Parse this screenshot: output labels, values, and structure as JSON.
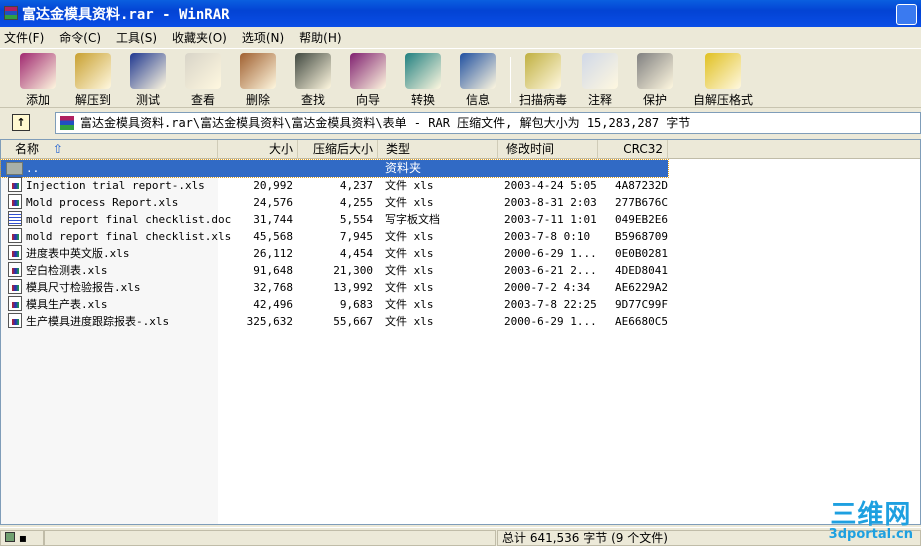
{
  "window": {
    "title": "富达金模具资料.rar - WinRAR"
  },
  "menu": [
    "文件(F)",
    "命令(C)",
    "工具(S)",
    "收藏夹(O)",
    "选项(N)",
    "帮助(H)"
  ],
  "toolbar": [
    {
      "label": "添加",
      "icon": "add-archive-icon",
      "color": "#a02870"
    },
    {
      "label": "解压到",
      "icon": "extract-icon",
      "color": "#c8a030"
    },
    {
      "label": "测试",
      "icon": "test-icon",
      "color": "#203890"
    },
    {
      "label": "查看",
      "icon": "view-icon",
      "color": "#d8d4c8"
    },
    {
      "label": "删除",
      "icon": "delete-icon",
      "color": "#a06030"
    },
    {
      "label": "查找",
      "icon": "find-icon",
      "color": "#404840"
    },
    {
      "label": "向导",
      "icon": "wizard-icon",
      "color": "#802070"
    },
    {
      "label": "转换",
      "icon": "convert-icon",
      "color": "#208080"
    },
    {
      "label": "信息",
      "icon": "info-icon",
      "color": "#2050a0"
    },
    {
      "label": "扫描病毒",
      "icon": "virus-scan-icon",
      "color": "#c0b040"
    },
    {
      "label": "注释",
      "icon": "comment-icon",
      "color": "#d0d8e8"
    },
    {
      "label": "保护",
      "icon": "protect-icon",
      "color": "#808080"
    },
    {
      "label": "自解压格式",
      "icon": "sfx-icon",
      "color": "#e0c020"
    }
  ],
  "address": {
    "path": "富达金模具资料.rar\\富达金模具资料\\富达金模具资料\\表单 - RAR 压缩文件, 解包大小为 15,283,287 字节"
  },
  "columns": {
    "name": "名称",
    "size": "大小",
    "packed": "压缩后大小",
    "type": "类型",
    "modified": "修改时间",
    "crc": "CRC32"
  },
  "parent_row": {
    "name": "..",
    "type": "资料夹"
  },
  "files": [
    {
      "name": "Injection trial report-.xls",
      "size": "20,992",
      "packed": "4,237",
      "type": "文件 xls",
      "modified": "2003-4-24 5:05",
      "crc": "4A87232D",
      "kind": "xls"
    },
    {
      "name": "Mold process Report.xls",
      "size": "24,576",
      "packed": "4,255",
      "type": "文件 xls",
      "modified": "2003-8-31 2:03",
      "crc": "277B676C",
      "kind": "xls"
    },
    {
      "name": "mold report final checklist.doc",
      "size": "31,744",
      "packed": "5,554",
      "type": "写字板文档",
      "modified": "2003-7-11 1:01",
      "crc": "049EB2E6",
      "kind": "doc"
    },
    {
      "name": "mold report final checklist.xls",
      "size": "45,568",
      "packed": "7,945",
      "type": "文件 xls",
      "modified": "2003-7-8 0:10",
      "crc": "B5968709",
      "kind": "xls"
    },
    {
      "name": "进度表中英文版.xls",
      "size": "26,112",
      "packed": "4,454",
      "type": "文件 xls",
      "modified": "2000-6-29 1...",
      "crc": "0E0B0281",
      "kind": "xls"
    },
    {
      "name": "空白检测表.xls",
      "size": "91,648",
      "packed": "21,300",
      "type": "文件 xls",
      "modified": "2003-6-21 2...",
      "crc": "4DED8041",
      "kind": "xls"
    },
    {
      "name": "模具尺寸检验报告.xls",
      "size": "32,768",
      "packed": "13,992",
      "type": "文件 xls",
      "modified": "2000-7-2 4:34",
      "crc": "AE6229A2",
      "kind": "xls"
    },
    {
      "name": "模具生产表.xls",
      "size": "42,496",
      "packed": "9,683",
      "type": "文件 xls",
      "modified": "2003-7-8 22:25",
      "crc": "9D77C99F",
      "kind": "xls"
    },
    {
      "name": "生产模具进度跟踪报表-.xls",
      "size": "325,632",
      "packed": "55,667",
      "type": "文件 xls",
      "modified": "2000-6-29 1...",
      "crc": "AE6680C5",
      "kind": "xls"
    }
  ],
  "status": {
    "total": "总计 641,536 字节 (9 个文件)"
  },
  "watermark": {
    "line1": "三维网",
    "line2": "3dportal.cn"
  }
}
